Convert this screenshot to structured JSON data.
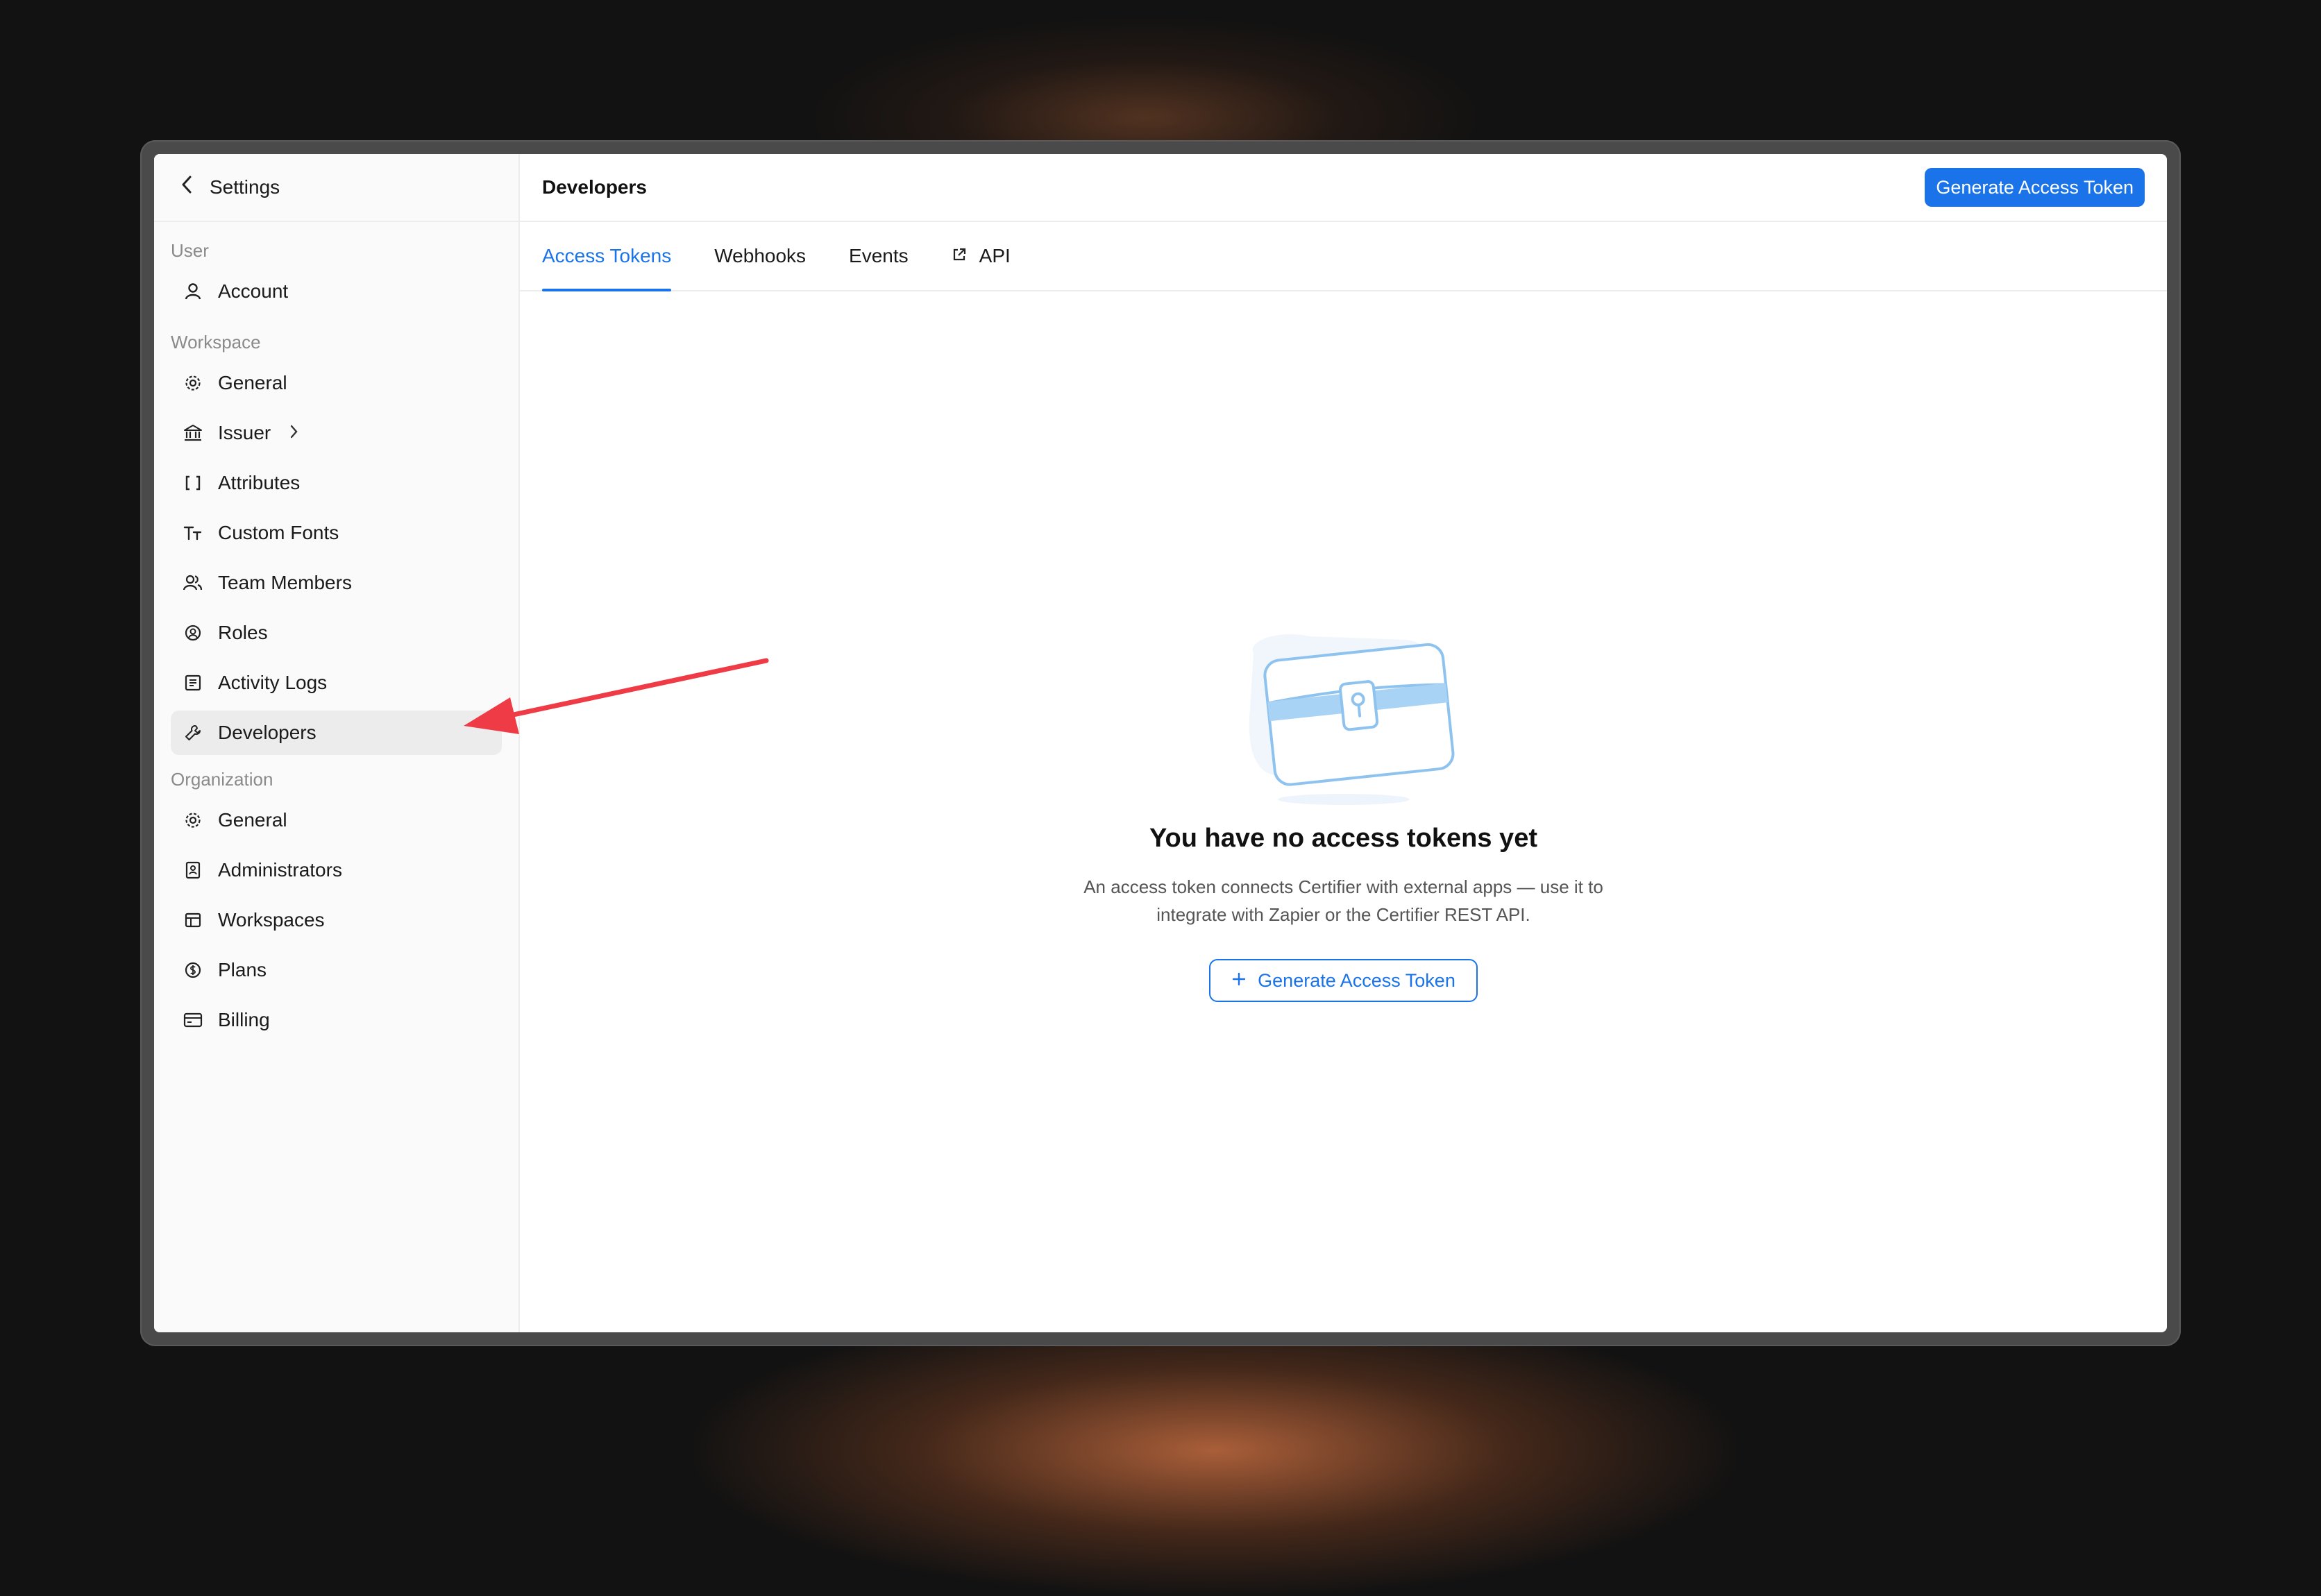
{
  "sidebar": {
    "header": {
      "title": "Settings"
    },
    "sections": [
      {
        "label": "User",
        "items": [
          {
            "label": "Account",
            "icon": "user-icon"
          }
        ]
      },
      {
        "label": "Workspace",
        "items": [
          {
            "label": "General",
            "icon": "gear-icon"
          },
          {
            "label": "Issuer",
            "icon": "bank-icon"
          },
          {
            "label": "Attributes",
            "icon": "brackets-icon"
          },
          {
            "label": "Custom Fonts",
            "icon": "font-icon"
          },
          {
            "label": "Team Members",
            "icon": "team-icon"
          },
          {
            "label": "Roles",
            "icon": "roles-icon"
          },
          {
            "label": "Activity Logs",
            "icon": "log-icon"
          },
          {
            "label": "Developers",
            "icon": "wrench-icon"
          }
        ]
      },
      {
        "label": "Organization",
        "items": [
          {
            "label": "General",
            "icon": "gear-icon"
          },
          {
            "label": "Administrators",
            "icon": "badge-icon"
          },
          {
            "label": "Workspaces",
            "icon": "layout-icon"
          },
          {
            "label": "Plans",
            "icon": "dollar-icon"
          },
          {
            "label": "Billing",
            "icon": "card-icon"
          }
        ]
      }
    ],
    "active_item": "Developers"
  },
  "main": {
    "title": "Developers",
    "primary_button": "Generate Access Token",
    "tabs": [
      {
        "label": "Access Tokens"
      },
      {
        "label": "Webhooks"
      },
      {
        "label": "Events"
      },
      {
        "label": "API",
        "icon": "external-link-icon"
      }
    ],
    "active_tab": "Access Tokens",
    "empty_state": {
      "illustration": "treasure-chest-illustration",
      "title": "You have no access tokens yet",
      "description": "An access token connects Certifier with external apps — use it to integrate with Zapier or the Certifier REST API.",
      "button": "Generate Access Token"
    }
  },
  "colors": {
    "accent": "#1a73e8",
    "annotation_arrow": "#ef3b46"
  }
}
